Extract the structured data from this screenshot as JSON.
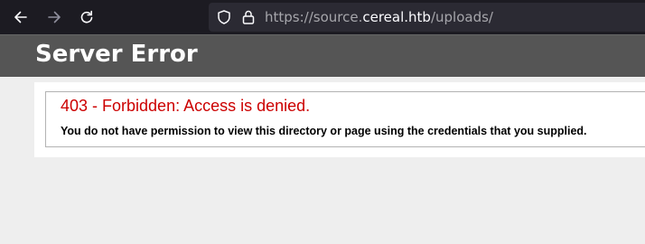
{
  "browser": {
    "url_prefix": "https://source.",
    "url_domain": "cereal.htb",
    "url_path": "/uploads/"
  },
  "header": {
    "title": "Server Error"
  },
  "error": {
    "title": "403 - Forbidden: Access is denied.",
    "message": "You do not have permission to view this directory or page using the credentials that you supplied."
  },
  "colors": {
    "toolbar_bg": "#1c1b22",
    "urlbar_bg": "#2b2a33",
    "header_bg": "#555555",
    "error_red": "#cc0000",
    "page_bg": "#eeeeee"
  }
}
